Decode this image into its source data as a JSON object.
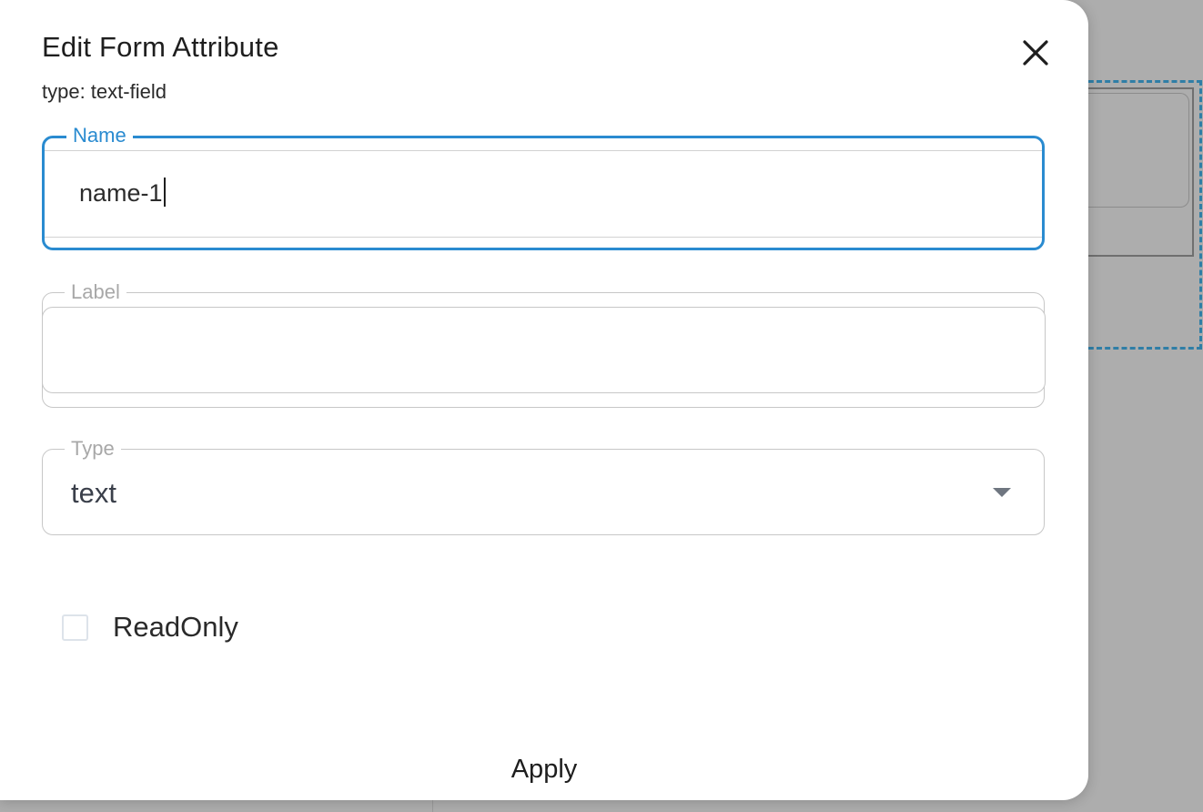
{
  "modal": {
    "title": "Edit Form Attribute",
    "subtitle": "type: text-field",
    "close_icon": "close-icon"
  },
  "fields": {
    "name": {
      "label": "Name",
      "value": "name-1",
      "state": "focused"
    },
    "label": {
      "label": "Label",
      "value": ""
    },
    "type": {
      "label": "Type",
      "value": "text",
      "icon": "chevron-down-icon"
    }
  },
  "readonly": {
    "label": "ReadOnly",
    "checked": false
  },
  "actions": {
    "apply_label": "Apply"
  },
  "colors": {
    "accent": "#2a8bd0",
    "border": "#c7c7c7",
    "overlay": "#adadad",
    "dashed_outline": "#2f7ea6"
  }
}
